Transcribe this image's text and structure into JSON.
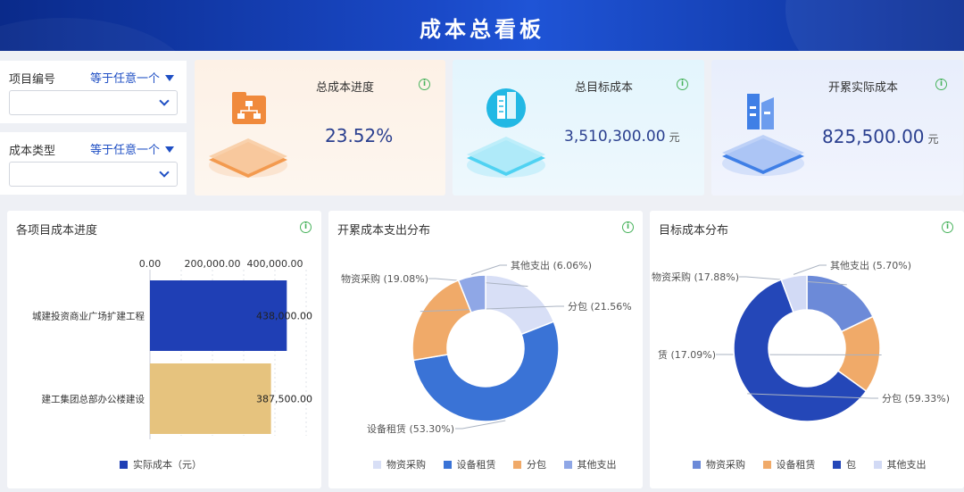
{
  "header": {
    "title": "成本总看板"
  },
  "filters": [
    {
      "label": "项目编号",
      "operator": "等于任意一个",
      "value": ""
    },
    {
      "label": "成本类型",
      "operator": "等于任意一个",
      "value": ""
    }
  ],
  "kpis": [
    {
      "title": "总成本进度",
      "value": "23.52%",
      "unit": "",
      "icon": "folder-org-icon",
      "color": "#f3924a"
    },
    {
      "title": "总目标成本",
      "value": "3,510,300.00",
      "unit": "元",
      "icon": "building-icon",
      "color": "#29c2e8"
    },
    {
      "title": "开累实际成本",
      "value": "825,500.00",
      "unit": "元",
      "icon": "buildings-icon",
      "color": "#3a7be8"
    }
  ],
  "charts": {
    "progress": {
      "title": "各项目成本进度"
    },
    "actual": {
      "title": "开累成本支出分布"
    },
    "target": {
      "title": "目标成本分布"
    }
  },
  "chart_data": [
    {
      "type": "bar",
      "orientation": "horizontal",
      "title": "各项目成本进度",
      "categories": [
        "城建投资商业广场扩建工程",
        "建工集团总部办公楼建设"
      ],
      "series": [
        {
          "name": "实际成本（元）",
          "values": [
            438000,
            387500
          ],
          "colors": [
            "#1f3fb5",
            "#e6c37e"
          ]
        }
      ],
      "data_labels": [
        "438,000.00",
        "387,500.00"
      ],
      "x_ticks": [
        "0.00",
        "200,000.00",
        "400,000.00"
      ],
      "xlim": [
        0,
        500000
      ],
      "legend": [
        "实际成本（元）"
      ]
    },
    {
      "type": "pie",
      "donut": true,
      "title": "开累成本支出分布",
      "slices": [
        {
          "name": "物资采购",
          "percent": 19.08,
          "label": "物资采购 (19.08%)",
          "color": "#d8dff6"
        },
        {
          "name": "设备租赁",
          "percent": 53.3,
          "label": "设备租赁 (53.30%)",
          "color": "#3a73d6"
        },
        {
          "name": "分包",
          "percent": 21.56,
          "label": "分包 (21.56%",
          "color": "#f0aa69"
        },
        {
          "name": "其他支出",
          "percent": 6.06,
          "label": "其他支出 (6.06%)",
          "color": "#8fa7e6"
        }
      ],
      "legend": [
        "物资采购",
        "设备租赁",
        "分包",
        "其他支出"
      ]
    },
    {
      "type": "pie",
      "donut": true,
      "title": "目标成本分布",
      "slices": [
        {
          "name": "物资采购",
          "percent": 17.88,
          "label": "物资采购 (17.88%)",
          "color": "#6c8ad8"
        },
        {
          "name": "设备租赁",
          "percent": 17.09,
          "label": "赁 (17.09%)",
          "color": "#f0aa69"
        },
        {
          "name": "分包",
          "percent": 59.33,
          "label": "分包 (59.33%)",
          "color": "#2447b8"
        },
        {
          "name": "其他支出",
          "percent": 5.7,
          "label": "其他支出 (5.70%)",
          "color": "#d2daf5"
        }
      ],
      "legend": [
        "物资采购",
        "设备租赁",
        "包",
        "其他支出"
      ]
    }
  ]
}
